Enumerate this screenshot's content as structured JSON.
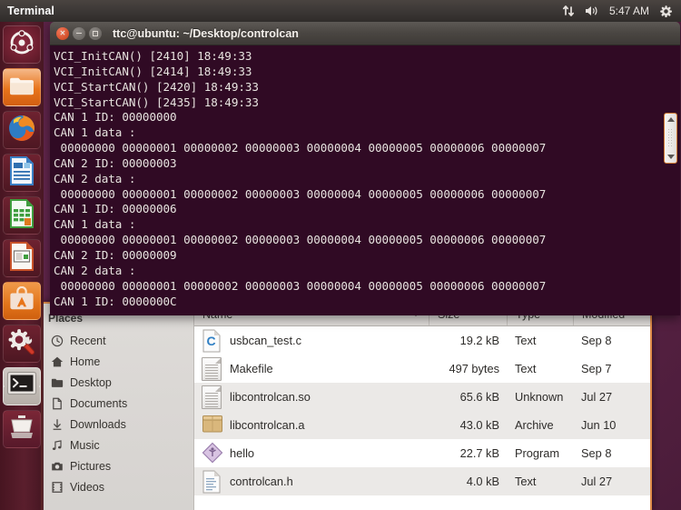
{
  "top_panel": {
    "app_title": "Terminal",
    "clock": "5:47 AM",
    "indicators": [
      "network-icon",
      "volume-icon",
      "session-gear-icon"
    ]
  },
  "launcher": {
    "items": [
      {
        "name": "ubuntu-dash",
        "label": "Ubuntu Dash",
        "icon": "ubuntu-logo-icon"
      },
      {
        "name": "files",
        "label": "Files",
        "icon": "folder-icon"
      },
      {
        "name": "firefox",
        "label": "Firefox Web Browser",
        "icon": "firefox-icon"
      },
      {
        "name": "writer",
        "label": "LibreOffice Writer",
        "icon": "writer-document-icon"
      },
      {
        "name": "calc",
        "label": "LibreOffice Calc",
        "icon": "spreadsheet-icon"
      },
      {
        "name": "impress",
        "label": "LibreOffice Impress",
        "icon": "presentation-icon"
      },
      {
        "name": "software-center",
        "label": "Ubuntu Software Center",
        "icon": "software-bag-icon"
      },
      {
        "name": "system-settings",
        "label": "System Settings",
        "icon": "gear-wrench-icon"
      },
      {
        "name": "terminal",
        "label": "Terminal",
        "icon": "terminal-prompt-icon"
      },
      {
        "name": "trash",
        "label": "Trash",
        "icon": "trash-bin-icon"
      }
    ]
  },
  "terminal": {
    "title": "ttc@ubuntu: ~/Desktop/controlcan",
    "window_buttons": {
      "close": "close-button",
      "minimize": "minimize-button",
      "maximize": "maximize-button"
    },
    "lines": [
      "VCI_InitCAN() [2410] 18:49:33",
      "VCI_InitCAN() [2414] 18:49:33",
      "VCI_StartCAN() [2420] 18:49:33",
      "VCI_StartCAN() [2435] 18:49:33",
      "CAN 1 ID: 00000000",
      "CAN 1 data :",
      " 00000000 00000001 00000002 00000003 00000004 00000005 00000006 00000007",
      "CAN 2 ID: 00000003",
      "CAN 2 data :",
      " 00000000 00000001 00000002 00000003 00000004 00000005 00000006 00000007",
      "CAN 1 ID: 00000006",
      "CAN 1 data :",
      " 00000000 00000001 00000002 00000003 00000004 00000005 00000006 00000007",
      "CAN 2 ID: 00000009",
      "CAN 2 data :",
      " 00000000 00000001 00000002 00000003 00000004 00000005 00000006 00000007",
      "CAN 1 ID: 0000000C"
    ]
  },
  "file_manager": {
    "sidebar": {
      "heading": "Places",
      "items": [
        {
          "label": "Recent",
          "icon": "clock-icon"
        },
        {
          "label": "Home",
          "icon": "home-icon"
        },
        {
          "label": "Desktop",
          "icon": "desktop-folder-icon"
        },
        {
          "label": "Documents",
          "icon": "document-icon"
        },
        {
          "label": "Downloads",
          "icon": "download-arrow-icon"
        },
        {
          "label": "Music",
          "icon": "music-note-icon"
        },
        {
          "label": "Pictures",
          "icon": "camera-icon"
        },
        {
          "label": "Videos",
          "icon": "film-strip-icon"
        }
      ]
    },
    "columns": [
      "Name",
      "Size",
      "Type",
      "Modified"
    ],
    "sort_column": "Name",
    "sort_indicator": "descending-caret-icon",
    "rows": [
      {
        "name": "usbcan_test.c",
        "size": "19.2 kB",
        "type": "Text",
        "modified": "Sep 8",
        "icon": "c-source-file-icon"
      },
      {
        "name": "Makefile",
        "size": "497 bytes",
        "type": "Text",
        "modified": "Sep 7",
        "icon": "text-file-icon"
      },
      {
        "name": "libcontrolcan.so",
        "size": "65.6 kB",
        "type": "Unknown",
        "modified": "Jul 27",
        "icon": "unknown-file-icon"
      },
      {
        "name": "libcontrolcan.a",
        "size": "43.0 kB",
        "type": "Archive",
        "modified": "Jun 10",
        "icon": "archive-box-icon"
      },
      {
        "name": "hello",
        "size": "22.7 kB",
        "type": "Program",
        "modified": "Sep 8",
        "icon": "executable-program-icon"
      },
      {
        "name": "controlcan.h",
        "size": "4.0 kB",
        "type": "Text",
        "modified": "Jul 27",
        "icon": "header-file-icon"
      }
    ]
  },
  "colors": {
    "terminal_background": "#300a24",
    "window_accent": "#e08d4a",
    "panel_background": "#3c3836",
    "desktop": "#5e2750"
  }
}
